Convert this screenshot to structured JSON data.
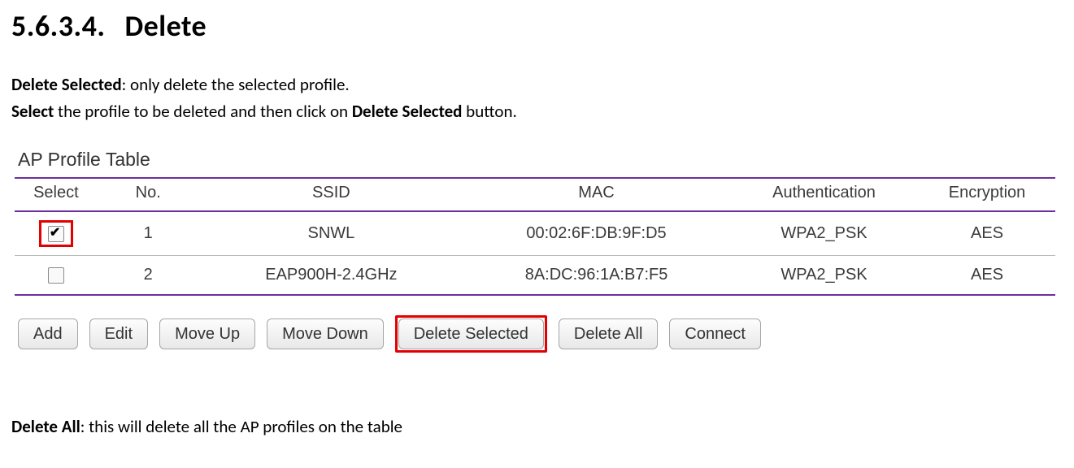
{
  "heading": {
    "number": "5.6.3.4.",
    "title": "Delete"
  },
  "intro": {
    "line1_b": "Delete Selected",
    "line1_rest": ": only delete the selected profile.",
    "line2_b1": "Select",
    "line2_mid": " the profile to be deleted and then click on ",
    "line2_b2": "Delete Selected",
    "line2_end": " button."
  },
  "panel": {
    "title": "AP Profile Table",
    "columns": {
      "select": "Select",
      "no": "No.",
      "ssid": "SSID",
      "mac": "MAC",
      "auth": "Authentication",
      "enc": "Encryption"
    },
    "rows": [
      {
        "checked": true,
        "no": "1",
        "ssid": "SNWL",
        "mac": "00:02:6F:DB:9F:D5",
        "auth": "WPA2_PSK",
        "enc": "AES"
      },
      {
        "checked": false,
        "no": "2",
        "ssid": "EAP900H-2.4GHz",
        "mac": "8A:DC:96:1A:B7:F5",
        "auth": "WPA2_PSK",
        "enc": "AES"
      }
    ],
    "buttons": {
      "add": "Add",
      "edit": "Edit",
      "moveup": "Move Up",
      "movedown": "Move Down",
      "deletesel": "Delete Selected",
      "deleteall": "Delete All",
      "connect": "Connect"
    }
  },
  "footer": {
    "b": "Delete All",
    "rest": ": this will delete all the AP profiles on the table"
  }
}
